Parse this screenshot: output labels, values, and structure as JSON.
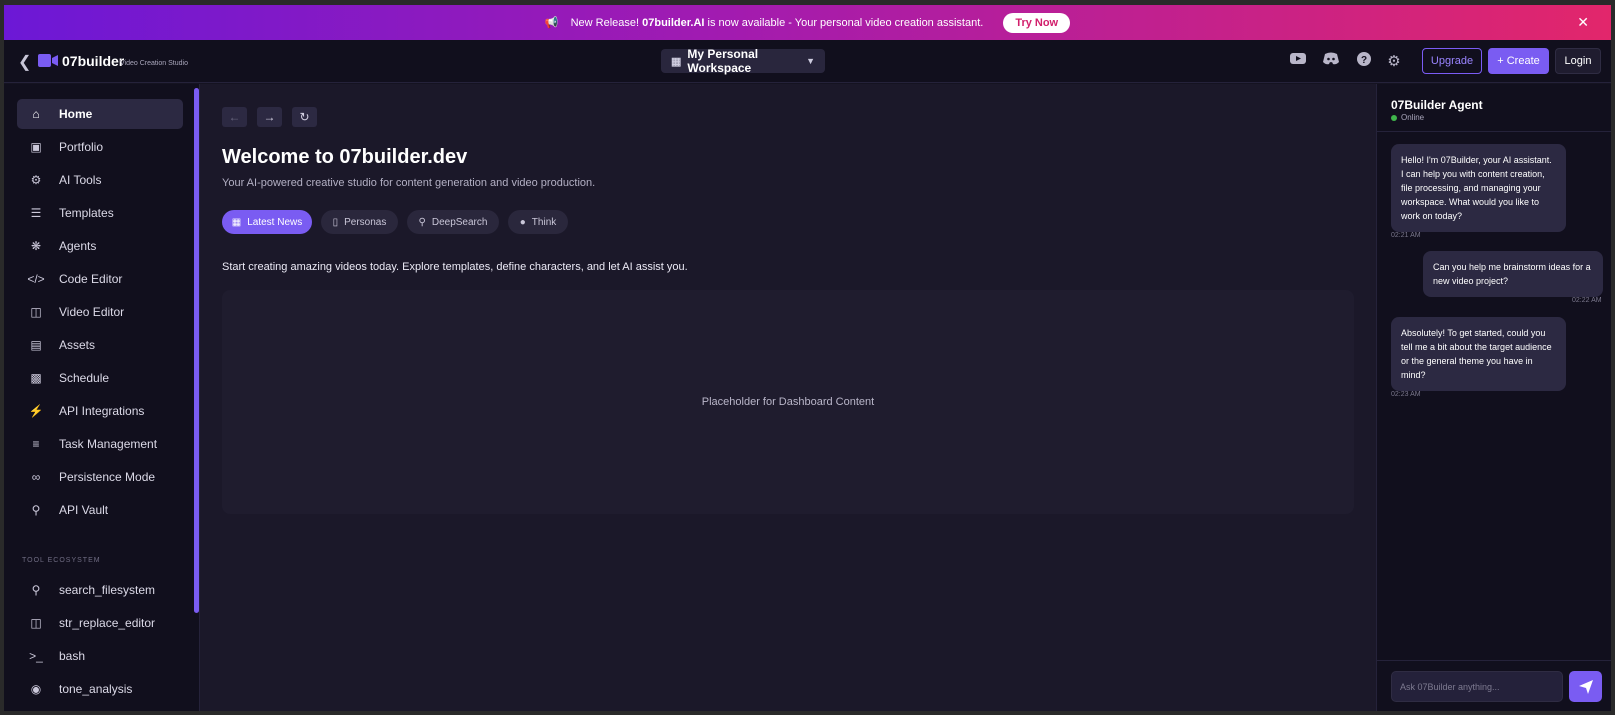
{
  "banner": {
    "prefix": "New Release!",
    "product": "07builder.AI",
    "suffix": "is now available - Your personal video creation assistant.",
    "cta": "Try Now"
  },
  "header": {
    "logo": "07builder",
    "subtitle": "Video Creation Studio",
    "workspace": "My Personal Workspace",
    "upgrade": "Upgrade",
    "create": "+ Create",
    "login": "Login"
  },
  "sidebar": {
    "items": [
      {
        "label": "Home",
        "icon": "home-icon"
      },
      {
        "label": "Portfolio",
        "icon": "briefcase-icon"
      },
      {
        "label": "AI Tools",
        "icon": "robot-icon"
      },
      {
        "label": "Templates",
        "icon": "layers-icon"
      },
      {
        "label": "Agents",
        "icon": "brain-icon"
      },
      {
        "label": "Code Editor",
        "icon": "code-icon"
      },
      {
        "label": "Video Editor",
        "icon": "film-icon"
      },
      {
        "label": "Assets",
        "icon": "archive-icon"
      },
      {
        "label": "Schedule",
        "icon": "calendar-icon"
      },
      {
        "label": "API Integrations",
        "icon": "plug-icon"
      },
      {
        "label": "Task Management",
        "icon": "tasks-icon"
      },
      {
        "label": "Persistence Mode",
        "icon": "infinity-icon"
      },
      {
        "label": "API Vault",
        "icon": "key-icon"
      }
    ],
    "section_title": "TOOL ECOSYSTEM",
    "tools": [
      {
        "label": "search_filesystem",
        "icon": "search-icon"
      },
      {
        "label": "str_replace_editor",
        "icon": "file-code-icon"
      },
      {
        "label": "bash",
        "icon": "terminal-icon"
      },
      {
        "label": "tone_analysis",
        "icon": "comment-icon"
      }
    ]
  },
  "main": {
    "title": "Welcome to 07builder.dev",
    "subtitle": "Your AI-powered creative studio for content generation and video production.",
    "tabs": [
      {
        "label": "Latest News",
        "icon": "newspaper-icon"
      },
      {
        "label": "Personas",
        "icon": "id-badge-icon"
      },
      {
        "label": "DeepSearch",
        "icon": "search-icon"
      },
      {
        "label": "Think",
        "icon": "lightbulb-icon"
      }
    ],
    "intro": "Start creating amazing videos today. Explore templates, define characters, and let AI assist you.",
    "placeholder": "Placeholder for Dashboard Content"
  },
  "chat": {
    "agent_name": "07Builder Agent",
    "status": "Online",
    "messages": [
      {
        "from": "agent",
        "text": "Hello! I'm 07Builder, your AI assistant. I can help you with content creation, file processing, and managing your workspace. What would you like to work on today?",
        "time": "02:21 AM"
      },
      {
        "from": "user",
        "text": "Can you help me brainstorm ideas for a new video project?",
        "time": "02:22 AM"
      },
      {
        "from": "agent",
        "text": "Absolutely! To get started, could you tell me a bit about the target audience or the general theme you have in mind?",
        "time": "02:23 AM"
      }
    ],
    "input_placeholder": "Ask 07Builder anything..."
  },
  "colors": {
    "accent": "#7a5cf2",
    "banner_start": "#6c18d6",
    "banner_end": "#e2266b",
    "online": "#3fb54b"
  }
}
